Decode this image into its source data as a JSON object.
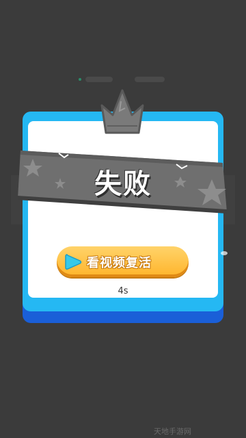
{
  "dialog": {
    "title": "失败",
    "revive_button_label": "看视频复活",
    "countdown": "4s"
  },
  "watermark": "天地手游网",
  "colors": {
    "backdrop": "#3b3b3b",
    "panel_border": "#25b8f3",
    "panel_shadow": "#1a5fd8",
    "ribbon": "#6f6f6f",
    "button": "#ffb42a",
    "play_icon": "#36c9e8"
  },
  "icons": {
    "crown": "crown-icon",
    "play": "play-icon",
    "stars": "star-icon"
  }
}
